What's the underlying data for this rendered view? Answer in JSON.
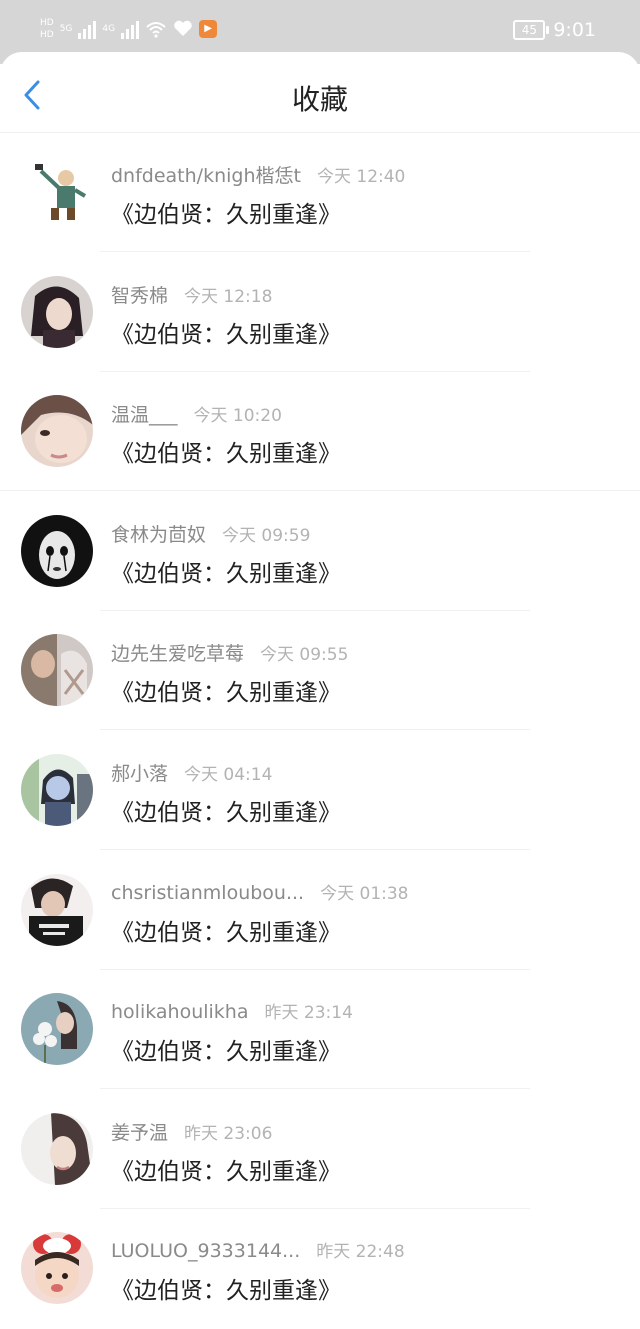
{
  "status_bar": {
    "network_tags": [
      "HD",
      "5G",
      "4G"
    ],
    "battery": "45",
    "time": "9:01"
  },
  "header": {
    "back_icon": "chevron-left-icon",
    "title": "收藏"
  },
  "colors": {
    "accent": "#3a8ee6",
    "statusbar": "#d6d6d6",
    "text_primary": "#222222",
    "text_secondary": "#8a8a8a",
    "text_tertiary": "#b3b3b3"
  },
  "items": [
    {
      "name": "dnfdeath/knigh楷恁t",
      "time": "今天 12:40",
      "work": "《边伯贤：久别重逢》"
    },
    {
      "name": "智秀棉",
      "time": "今天 12:18",
      "work": "《边伯贤：久别重逢》"
    },
    {
      "name": "温温___",
      "time": "今天 10:20",
      "work": "《边伯贤：久别重逢》"
    },
    {
      "name": "食林为茴奴",
      "time": "今天 09:59",
      "work": "《边伯贤：久别重逢》"
    },
    {
      "name": "边先生爱吃草莓",
      "time": "今天 09:55",
      "work": "《边伯贤：久别重逢》"
    },
    {
      "name": "郝小落",
      "time": "今天 04:14",
      "work": "《边伯贤：久别重逢》"
    },
    {
      "name": "chsristianmloubou...",
      "time": "今天 01:38",
      "work": "《边伯贤：久别重逢》"
    },
    {
      "name": "holikahoulikha",
      "time": "昨天 23:14",
      "work": "《边伯贤：久别重逢》"
    },
    {
      "name": "姜予温",
      "time": "昨天 23:06",
      "work": "《边伯贤：久别重逢》"
    },
    {
      "name": "LUOLUO_9333144...",
      "time": "昨天 22:48",
      "work": "《边伯贤：久别重逢》"
    }
  ]
}
